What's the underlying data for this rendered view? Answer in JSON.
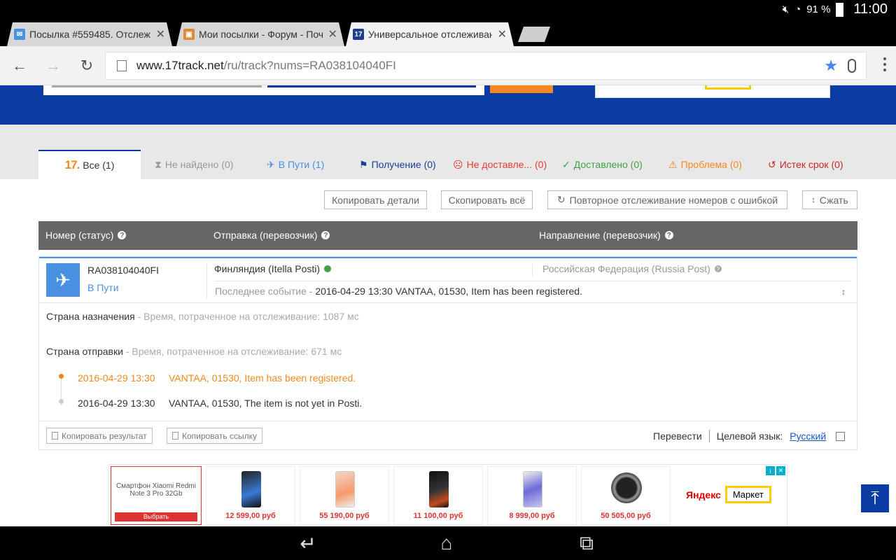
{
  "status_bar": {
    "battery": "91 %",
    "time": "11:00"
  },
  "tabs": [
    {
      "title": "Посылка #559485. Отслеж",
      "favicon": "mail-icon"
    },
    {
      "title": "Мои посылки - Форум - Поч",
      "favicon": "gift-icon"
    },
    {
      "title": "Универсальное отслеживан",
      "favicon": "17track-icon"
    }
  ],
  "omnibox": {
    "host": "www.17track.net",
    "path": "/ru/track?nums=RA038104040FI"
  },
  "filter_tabs": {
    "all": "Все (1)",
    "not_found": "Не найдено (0)",
    "in_transit": "В Пути (1)",
    "pickup": "Получение (0)",
    "undelivered": "Не доставле... (0)",
    "delivered": "Доставлено (0)",
    "problem": "Проблема (0)",
    "expired": "Истек срок (0)"
  },
  "actions": {
    "copy_details": "Копировать детали",
    "copy_all": "Скопировать всё",
    "retrack": "Повторное отслеживание номеров с ошибкой",
    "collapse": "Сжать"
  },
  "table_header": {
    "number": "Номер (статус)",
    "origin": "Отправка (перевозчик)",
    "destination": "Направление (перевозчик)"
  },
  "shipment": {
    "number": "RA038104040FI",
    "status": "В Пути",
    "origin": "Финляндия (Itella Posti)",
    "destination": "Российская Федерация (Russia Post)",
    "last_event_label": "Последнее событие -",
    "last_event": "2016-04-29 13:30 VANTAA, 01530, Item has been registered.",
    "dest_country_label": "Страна назначения",
    "dest_time": "- Время, потраченное на отслеживание: 1087 мс",
    "origin_country_label": "Страна отправки",
    "origin_time": "- Время, потраченное на отслеживание: 671 мс",
    "events": [
      {
        "date": "2016-04-29 13:30",
        "text": "VANTAA, 01530, Item has been registered."
      },
      {
        "date": "2016-04-29 13:30",
        "text": "VANTAA, 01530, The item is not yet in Posti."
      }
    ]
  },
  "card_footer": {
    "copy_result": "Копировать результат",
    "copy_link": "Копировать ссылку",
    "translate": "Перевести",
    "target_lang_label": "Целевой язык:",
    "target_lang": "Русский"
  },
  "ad": {
    "first_title": "Смартфон Xiaomi Redmi Note 3 Pro 32Gb",
    "first_button": "Выбрать",
    "prices": [
      "12 599,00 руб",
      "55 190,00 руб",
      "11 100,00 руб",
      "8 999,00 руб",
      "50 505,00 руб"
    ],
    "brand": "Яндекс",
    "market": "Маркет"
  },
  "colors": {
    "brand_blue": "#0a3ca3",
    "accent_orange": "#f5891f",
    "transit_blue": "#4a90e2"
  }
}
